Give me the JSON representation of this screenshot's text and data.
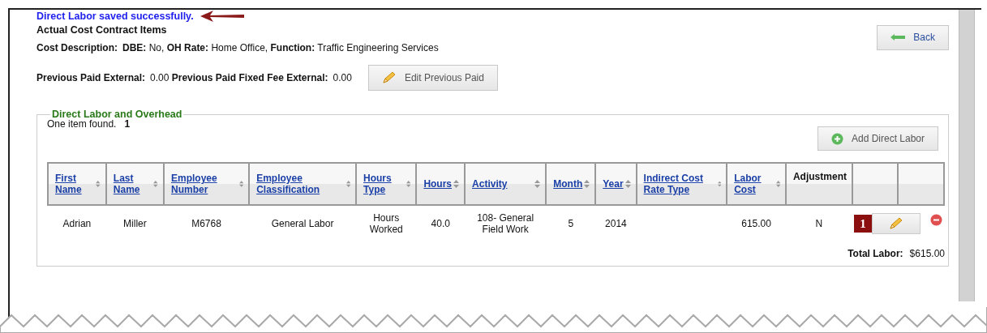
{
  "message": "Direct Labor saved successfully.",
  "title": "Actual Cost Contract Items",
  "cost_description": {
    "label": "Cost Description:",
    "text": "**DBE:** No, **OH Rate:** Home Office, **Function:** Traffic Engineering Services"
  },
  "back_button": "Back",
  "previous_paid": [
    {
      "label": "Previous Paid External:",
      "value": "0.00"
    },
    {
      "label": "Previous Paid Fixed Fee External:",
      "value": "0.00"
    }
  ],
  "edit_previous_paid_button": "Edit Previous Paid",
  "section": {
    "legend": "Direct Labor and Overhead",
    "count_text": "One item found.",
    "page": "1",
    "add_button": "Add Direct Labor"
  },
  "table": {
    "columns": [
      {
        "label": "First Name",
        "sortable": true
      },
      {
        "label": "Last Name",
        "sortable": true
      },
      {
        "label": "Employee Number",
        "sortable": true
      },
      {
        "label": "Employee Classification",
        "sortable": true
      },
      {
        "label": "Hours Type",
        "sortable": true
      },
      {
        "label": "Hours",
        "sortable": true
      },
      {
        "label": "Activity",
        "sortable": true
      },
      {
        "label": "Month",
        "sortable": true
      },
      {
        "label": "Year",
        "sortable": true
      },
      {
        "label": "Indirect Cost Rate Type",
        "sortable": true
      },
      {
        "label": "Labor Cost",
        "sortable": true
      },
      {
        "label": "Adjustment",
        "sortable": false
      },
      {
        "sortable": false
      },
      {
        "sortable": false
      }
    ],
    "rows": [
      {
        "cells": [
          "Adrian",
          "Miller",
          "M6768",
          "General Labor",
          "Hours Worked",
          "40.0",
          "108- General Field Work",
          "5",
          "2014",
          "",
          "615.00",
          "N"
        ],
        "callout": "1"
      }
    ]
  },
  "total": {
    "label": "Total Labor:",
    "value": "$615.00"
  }
}
